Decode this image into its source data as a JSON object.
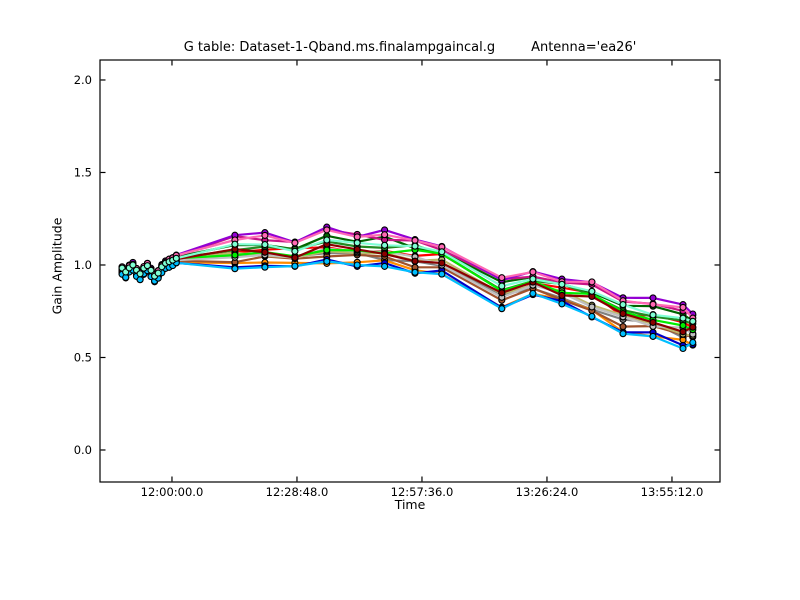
{
  "header": {
    "title_main": "G table: Dataset-1-Qband.ms.finalampgaincal.g",
    "title_antenna": "Antenna='ea26'"
  },
  "chart_data": {
    "type": "line",
    "title": "G table: Dataset-1-Qband.ms.finalampgaincal.g     Antenna='ea26'",
    "xlabel": "Time",
    "ylabel": "Gain Amplitude",
    "legend": "none",
    "grid": "off",
    "marker": "circle",
    "x_tick_labels": [
      "12:00:00.0",
      "12:28:48.0",
      "12:57:36.0",
      "13:26:24.0",
      "13:55:12.0"
    ],
    "y_tick_labels": [
      "0.0",
      "0.5",
      "1.0",
      "1.5",
      "2.0"
    ],
    "xlim_seconds": [
      42205,
      50776
    ],
    "ylim": [
      -0.173,
      2.108
    ],
    "x_times": [
      "11:48:30",
      "11:49:20",
      "11:50:10",
      "11:51:00",
      "11:51:50",
      "11:52:40",
      "11:53:30",
      "11:54:20",
      "11:55:10",
      "11:56:00",
      "11:56:50",
      "11:57:40",
      "11:58:30",
      "11:59:20",
      "12:00:10",
      "12:01:00",
      "12:14:30",
      "12:21:25",
      "12:28:20",
      "12:35:40",
      "12:42:40",
      "12:49:00",
      "12:56:00",
      "13:02:10",
      "13:16:00",
      "13:23:10",
      "13:29:50",
      "13:36:45",
      "13:43:55",
      "13:50:50",
      "13:57:45",
      "14:00:00"
    ],
    "mean_amplitude": [
      0.97,
      0.95,
      0.98,
      0.99,
      0.96,
      0.94,
      0.97,
      0.99,
      0.96,
      0.93,
      0.95,
      0.98,
      1.0,
      1.01,
      1.02,
      1.03,
      1.07,
      1.08,
      1.06,
      1.1,
      1.08,
      1.08,
      1.05,
      1.03,
      0.85,
      0.9,
      0.86,
      0.81,
      0.73,
      0.71,
      0.67,
      0.65
    ],
    "band_halfwidth": [
      0.02,
      0.02,
      0.02,
      0.02,
      0.02,
      0.02,
      0.02,
      0.02,
      0.02,
      0.02,
      0.02,
      0.02,
      0.02,
      0.02,
      0.02,
      0.02,
      0.085,
      0.08,
      0.07,
      0.09,
      0.08,
      0.095,
      0.09,
      0.08,
      0.075,
      0.065,
      0.07,
      0.09,
      0.09,
      0.095,
      0.105,
      0.08
    ],
    "series": [
      {
        "name": "series-01",
        "color": "#808080",
        "offset": -0.35,
        "wobble": 0.5
      },
      {
        "name": "series-02",
        "color": "#ff8c00",
        "offset": -0.75,
        "wobble": 0.6
      },
      {
        "name": "series-03",
        "color": "#a0522d",
        "offset": -0.55,
        "wobble": 0.5
      },
      {
        "name": "series-04",
        "color": "#0000cd",
        "offset": -0.92,
        "wobble": 0.4
      },
      {
        "name": "series-05",
        "color": "#ff0000",
        "offset": 0.15,
        "wobble": 0.7
      },
      {
        "name": "series-06",
        "color": "#006400",
        "offset": 0.55,
        "wobble": 0.5
      },
      {
        "name": "series-07",
        "color": "#c71585",
        "offset": 0.82,
        "wobble": 0.5
      },
      {
        "name": "series-08",
        "color": "#bdb76b",
        "offset": -0.15,
        "wobble": 0.6
      },
      {
        "name": "series-09",
        "color": "#c0c0c0",
        "offset": -0.28,
        "wobble": 0.5
      },
      {
        "name": "series-10",
        "color": "#228b22",
        "offset": 0.35,
        "wobble": 0.6
      },
      {
        "name": "series-11",
        "color": "#00ee00",
        "offset": 0.05,
        "wobble": 0.7
      },
      {
        "name": "series-12",
        "color": "#8b0000",
        "offset": -0.05,
        "wobble": 0.6
      },
      {
        "name": "series-13",
        "color": "#9400d3",
        "offset": 1.0,
        "wobble": 0.4
      },
      {
        "name": "series-14",
        "color": "#00bfff",
        "offset": -1.0,
        "wobble": 0.35
      },
      {
        "name": "series-15",
        "color": "#ff69b4",
        "offset": 0.9,
        "wobble": 0.45
      },
      {
        "name": "series-16",
        "color": "#7fffd4",
        "offset": 0.45,
        "wobble": 0.5
      }
    ],
    "axis_color": "#000000",
    "background_color": "#ffffff"
  }
}
